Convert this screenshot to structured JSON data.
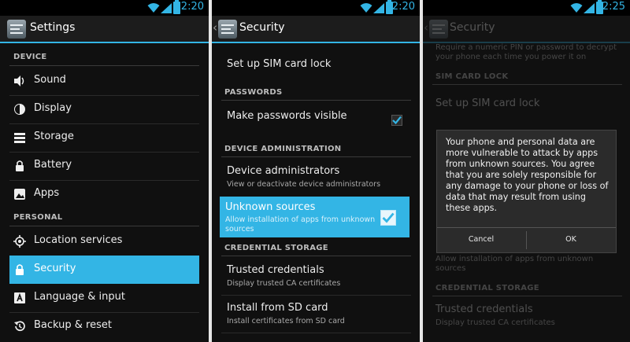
{
  "colors": {
    "accent": "#33b5e5",
    "background": "#101010",
    "text": "#ededed"
  },
  "screen1": {
    "status": {
      "time": "12:20",
      "icons": [
        "wifi-icon",
        "signal-icon",
        "battery-icon"
      ]
    },
    "app_icon": "settings-icon",
    "title": "Settings",
    "device_header": "DEVICE",
    "device_items": [
      {
        "label": "Sound",
        "icon": "speaker-icon"
      },
      {
        "label": "Display",
        "icon": "brightness-icon"
      },
      {
        "label": "Storage",
        "icon": "storage-icon"
      },
      {
        "label": "Battery",
        "icon": "battery-icon"
      },
      {
        "label": "Apps",
        "icon": "apps-icon"
      }
    ],
    "personal_header": "PERSONAL",
    "personal_items": [
      {
        "label": "Location services",
        "icon": "location-icon"
      },
      {
        "label": "Security",
        "icon": "lock-icon",
        "selected": true
      },
      {
        "label": "Language & input",
        "icon": "keyboard-icon"
      },
      {
        "label": "Backup & reset",
        "icon": "restore-icon"
      }
    ]
  },
  "screen2": {
    "status": {
      "time": "12:20"
    },
    "title": "Security",
    "sim_lock": "Set up SIM card lock",
    "passwords_header": "PASSWORDS",
    "make_visible": {
      "title": "Make passwords visible",
      "checked": true
    },
    "device_admin_header": "DEVICE ADMINISTRATION",
    "device_admins": {
      "title": "Device administrators",
      "summary": "View or deactivate device administrators"
    },
    "unknown_sources": {
      "title": "Unknown sources",
      "summary_line1": "Allow installation of apps from unknown",
      "summary_line2": "sources",
      "checked": true
    },
    "credential_header": "CREDENTIAL STORAGE",
    "trusted": {
      "title": "Trusted credentials",
      "summary": "Display trusted CA certificates"
    },
    "install_sd": {
      "title": "Install from SD card",
      "summary": "Install certificates from SD card"
    }
  },
  "screen3": {
    "status": {
      "time": "12:25"
    },
    "title": "Security",
    "top_summary_line1": "Require a numeric PIN or password to decrypt",
    "top_summary_line2": "your phone each time you power it on",
    "sim_header": "SIM CARD LOCK",
    "sim_lock": "Set up SIM card lock",
    "bg_summary_line1": "Allow installation of apps from unknown",
    "bg_summary_line2": "sources",
    "credential_header": "CREDENTIAL STORAGE",
    "trusted": {
      "title": "Trusted credentials",
      "summary": "Display trusted CA certificates"
    },
    "dialog": {
      "message": "Your phone and personal data are more vulnerable to attack by apps from unknown sources. You agree that you are solely responsible for any damage to your phone or loss of data that may result from using these apps.",
      "cancel": "Cancel",
      "ok": "OK"
    }
  }
}
